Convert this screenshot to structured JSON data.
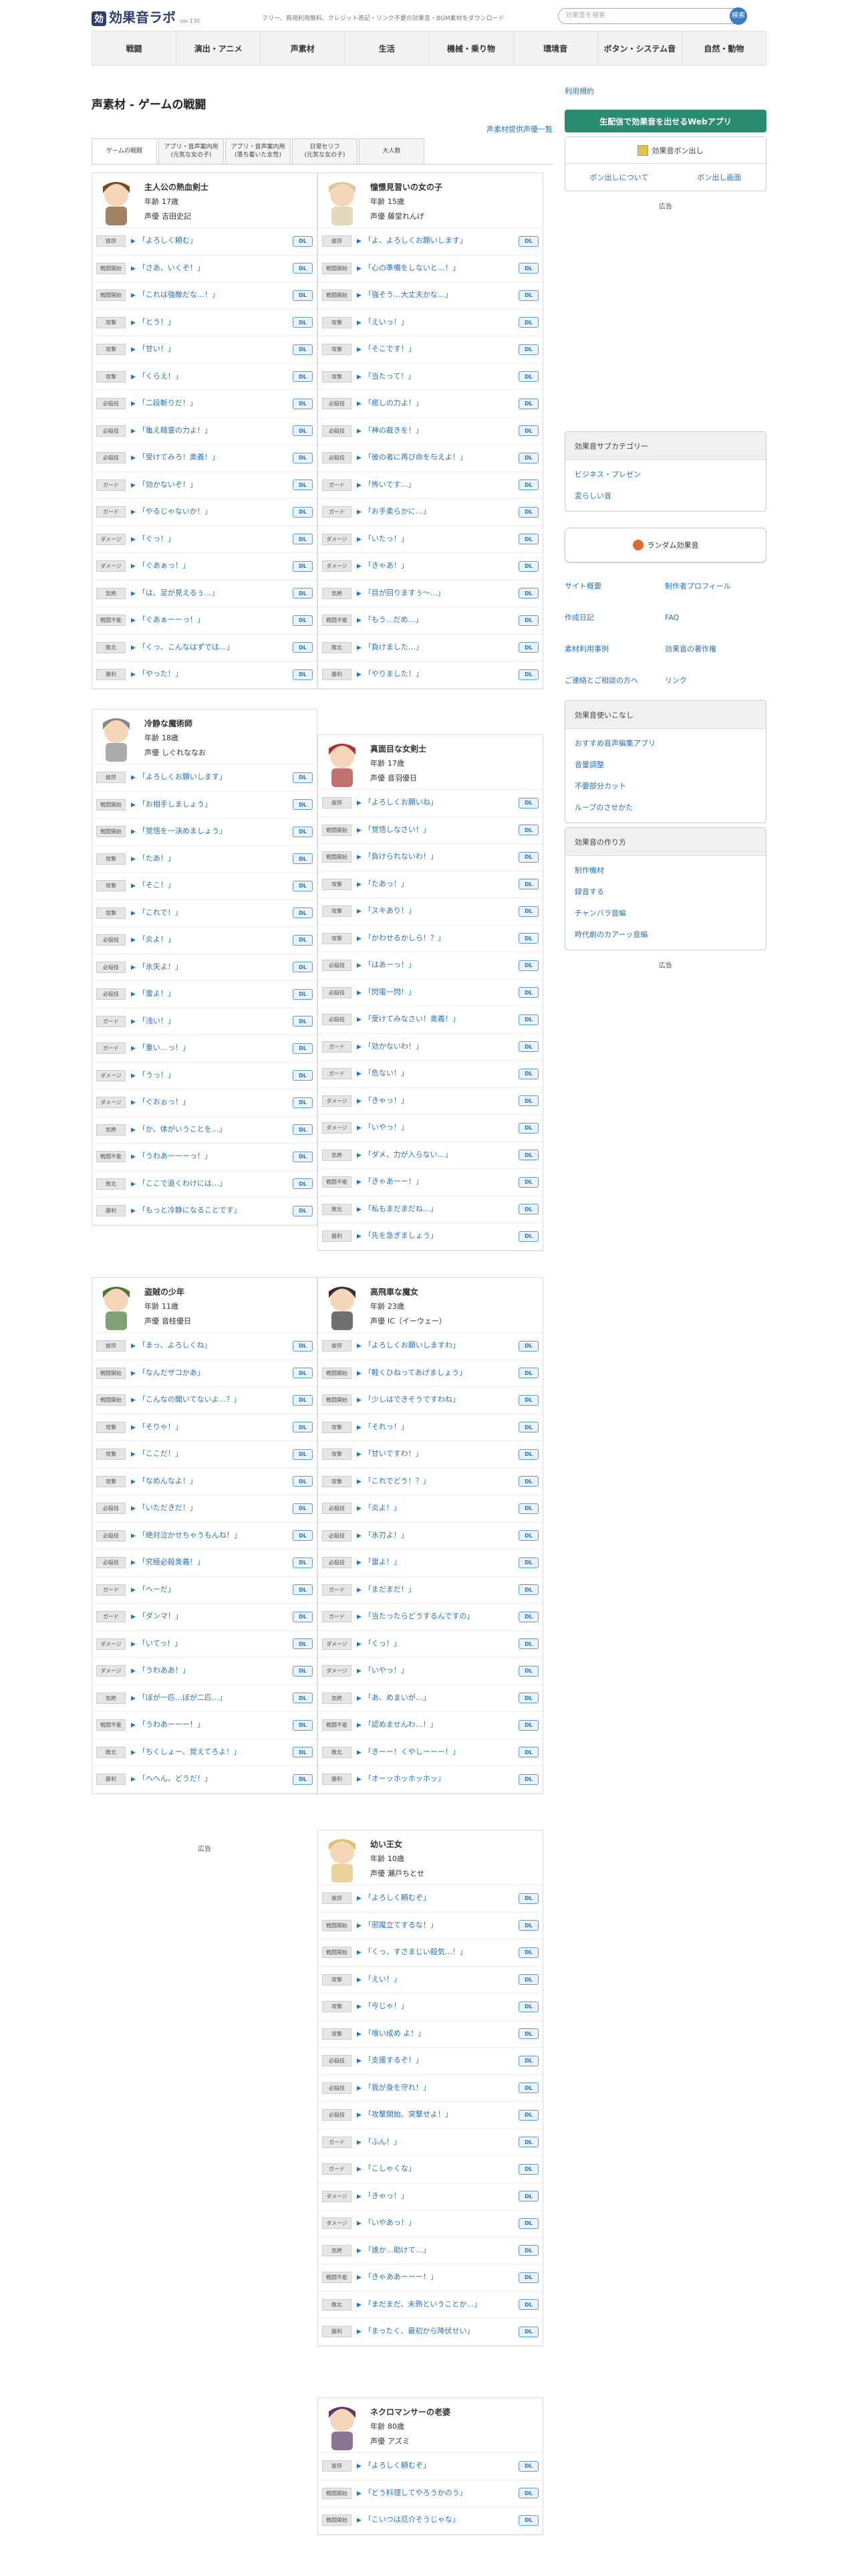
{
  "header": {
    "logo_mark": "効",
    "logo_text": "効果音ラボ",
    "version": "ver.130",
    "tagline": "フリー、商用利用無料、クレジット表記・リンク不要の効果音・BGM素材をダウンロード",
    "search_placeholder": "効果音を検索",
    "search_button": "検索"
  },
  "nav": [
    "戦闘",
    "演出・アニメ",
    "声素材",
    "生活",
    "機械・乗り物",
    "環境音",
    "ボタン・システム音",
    "自然・動物"
  ],
  "main": {
    "title": "声素材 - ゲームの戦闘",
    "provider_link": "声素材提供声優一覧",
    "tabs": [
      "ゲームの戦闘",
      "アプリ・音声案内用\n(元気な女の子)",
      "アプリ・音声案内用\n(落ち着いた女性)",
      "日常セリフ\n(元気な女の子)",
      "大人数"
    ]
  },
  "labels": {
    "age": "年齢",
    "voice": "声優",
    "play": "▶",
    "dl": "DL",
    "ad": "広告"
  },
  "characters": [
    {
      "name": "主人公の熱血剣士",
      "age": "17歳",
      "voice": "吉田史記",
      "lines": [
        [
          "挨拶",
          "「よろしく頼む」"
        ],
        [
          "戦闘開始",
          "「さあ、いくぞ！」"
        ],
        [
          "戦闘開始",
          "「これは強敵だな…！」"
        ],
        [
          "攻撃",
          "「とう！」"
        ],
        [
          "攻撃",
          "「甘い！」"
        ],
        [
          "攻撃",
          "「くらえ！」"
        ],
        [
          "必殺技",
          "「二段斬りだ！」"
        ],
        [
          "必殺技",
          "「亀え精霊の力よ！」"
        ],
        [
          "必殺技",
          "「受けてみろ！奥義！」"
        ],
        [
          "ガード",
          "「効かないぞ！」"
        ],
        [
          "ガード",
          "「やるじゃないか！」"
        ],
        [
          "ダメージ",
          "「ぐっ！」"
        ],
        [
          "ダメージ",
          "「ぐあぁっ！」"
        ],
        [
          "気絶",
          "「は、足が見えるぅ…」"
        ],
        [
          "戦闘不能",
          "「ぐあぁーーっ！」"
        ],
        [
          "敗北",
          "「くっ、こんなはずでは…」"
        ],
        [
          "勝利",
          "「やった！」"
        ]
      ]
    },
    {
      "name": "憧憬見習いの女の子",
      "age": "15歳",
      "voice": "藤堂れんげ",
      "lines": [
        [
          "挨拶",
          "「よ、よろしくお願いします」"
        ],
        [
          "戦闘開始",
          "「心の準備をしないと…！」"
        ],
        [
          "戦闘開始",
          "「強そう…大丈夫かな…」"
        ],
        [
          "攻撃",
          "「えいっ！」"
        ],
        [
          "攻撃",
          "「そこです！」"
        ],
        [
          "攻撃",
          "「当たって！」"
        ],
        [
          "必殺技",
          "「癒しの力よ！」"
        ],
        [
          "必殺技",
          "「神の裁きを！」"
        ],
        [
          "必殺技",
          "「彼の者に再び命を与えよ！」"
        ],
        [
          "ガード",
          "「怖いです…」"
        ],
        [
          "ガード",
          "「お手柔らかに…」"
        ],
        [
          "ダメージ",
          "「いたっ！」"
        ],
        [
          "ダメージ",
          "「きゃあ！」"
        ],
        [
          "気絶",
          "「目が回りますぅ〜…」"
        ],
        [
          "戦闘不能",
          "「もう…だめ…」"
        ],
        [
          "敗北",
          "「負けました…」"
        ],
        [
          "勝利",
          "「やりました！」"
        ]
      ]
    },
    {
      "name": "冷静な魔術師",
      "age": "18歳",
      "voice": "しぐれななお",
      "lines": [
        [
          "挨拶",
          "「よろしくお願いします」"
        ],
        [
          "戦闘開始",
          "「お相手しましょう」"
        ],
        [
          "戦闘開始",
          "「覚悟を一決めましょう」"
        ],
        [
          "攻撃",
          "「たあ！」"
        ],
        [
          "攻撃",
          "「そこ！」"
        ],
        [
          "攻撃",
          "「これで！」"
        ],
        [
          "必殺技",
          "「炎よ！」"
        ],
        [
          "必殺技",
          "「氷矢よ！」"
        ],
        [
          "必殺技",
          "「雷よ！」"
        ],
        [
          "ガード",
          "「浅い！」"
        ],
        [
          "ガード",
          "「重い…っ！」"
        ],
        [
          "ダメージ",
          "「うっ！」"
        ],
        [
          "ダメージ",
          "「ぐおぉっ！」"
        ],
        [
          "気絶",
          "「か、体がいうことを…」"
        ],
        [
          "戦闘不能",
          "「うわあーーーっ！」"
        ],
        [
          "敗北",
          "「ここで退くわけには…」"
        ],
        [
          "勝利",
          "「もっと冷静になることです」"
        ]
      ]
    },
    {
      "name": "真面目な女剣士",
      "age": "17歳",
      "voice": "音羽優日",
      "lines": [
        [
          "挨拶",
          "「よろしくお願いね」"
        ],
        [
          "戦闘開始",
          "「覚悟しなさい！」"
        ],
        [
          "戦闘開始",
          "「負けられないわ！」"
        ],
        [
          "攻撃",
          "「たあっ！」"
        ],
        [
          "攻撃",
          "「スキあり！」"
        ],
        [
          "攻撃",
          "「かわせるかしら！？」"
        ],
        [
          "必殺技",
          "「はあーっ！」"
        ],
        [
          "必殺技",
          "「閃電一閃！」"
        ],
        [
          "必殺技",
          "「受けてみなさい！奥義！」"
        ],
        [
          "ガード",
          "「効かないわ！」"
        ],
        [
          "ガード",
          "「危ない！」"
        ],
        [
          "ダメージ",
          "「きゃっ！」"
        ],
        [
          "ダメージ",
          "「いやっ！」"
        ],
        [
          "気絶",
          "「ダメ、力が入らない…」"
        ],
        [
          "戦闘不能",
          "「きゃあーー！」"
        ],
        [
          "敗北",
          "「私もまだまだね…」"
        ],
        [
          "勝利",
          "「先を急ぎましょう」"
        ]
      ]
    },
    {
      "name": "盗賊の少年",
      "age": "11歳",
      "voice": "音桂優日",
      "lines": [
        [
          "挨拶",
          "「まっ、よろしくね」"
        ],
        [
          "戦闘開始",
          "「なんだザコかあ」"
        ],
        [
          "戦闘開始",
          "「こんなの聞いてないよ…？」"
        ],
        [
          "攻撃",
          "「そりゃ！」"
        ],
        [
          "攻撃",
          "「ここだ！」"
        ],
        [
          "攻撃",
          "「なめんなよ！」"
        ],
        [
          "必殺技",
          "「いただきだ！」"
        ],
        [
          "必殺技",
          "「絶対泣かせちゃうもんね！」"
        ],
        [
          "必殺技",
          "「究極必殺奥義！」"
        ],
        [
          "ガード",
          "「へーだ」"
        ],
        [
          "ガード",
          "「ダンマ！」"
        ],
        [
          "ダメージ",
          "「いてっ！」"
        ],
        [
          "ダメージ",
          "「うわああ！」"
        ],
        [
          "気絶",
          "「ぼが一匹…ぼが二匹…」"
        ],
        [
          "戦闘不能",
          "「うわあーーー！」"
        ],
        [
          "敗北",
          "「ちくしょー、覚えてろよ！」"
        ],
        [
          "勝利",
          "「へへん、どうだ！」"
        ]
      ]
    },
    {
      "name": "高飛車な魔女",
      "age": "23歳",
      "voice": "IC（イーウェー）",
      "lines": [
        [
          "挨拶",
          "「よろしくお願いしますわ」"
        ],
        [
          "戦闘開始",
          "「軽くひねってあげましょう」"
        ],
        [
          "戦闘開始",
          "「少しはできそうですわね」"
        ],
        [
          "攻撃",
          "「それっ！」"
        ],
        [
          "攻撃",
          "「甘いですわ！」"
        ],
        [
          "攻撃",
          "「これでどう！？」"
        ],
        [
          "必殺技",
          "「炎よ！」"
        ],
        [
          "必殺技",
          "「氷刃よ！」"
        ],
        [
          "必殺技",
          "「雷よ！」"
        ],
        [
          "ガード",
          "「まだまだ！」"
        ],
        [
          "ガード",
          "「当たったらどうするんですの」"
        ],
        [
          "ダメージ",
          "「くっ！」"
        ],
        [
          "ダメージ",
          "「いやっ！」"
        ],
        [
          "気絶",
          "「あ、めまいが…」"
        ],
        [
          "戦闘不能",
          "「認めませんわ…！」"
        ],
        [
          "敗北",
          "「きーー！くやしーーー！」"
        ],
        [
          "勝利",
          "「オーッホッホッホッ」"
        ]
      ]
    },
    {
      "name": "幼い王女",
      "age": "10歳",
      "voice": "瀬戸ちとせ",
      "lines": [
        [
          "挨拶",
          "「よろしく頼むぞ」"
        ],
        [
          "戦闘開始",
          "「邪魔立てするな！」"
        ],
        [
          "戦闘開始",
          "「くっ、すさまじい殺気…！」"
        ],
        [
          "攻撃",
          "「えい！」"
        ],
        [
          "攻撃",
          "「今じゃ！」"
        ],
        [
          "攻撃",
          "「喰い成め よ！」"
        ],
        [
          "必殺技",
          "「支援するぞ！」"
        ],
        [
          "必殺技",
          "「我が身を守れ！」"
        ],
        [
          "必殺技",
          "「攻撃開始、突撃せよ！」"
        ],
        [
          "ガード",
          "「ふん！」"
        ],
        [
          "ガード",
          "「こしゃくな」"
        ],
        [
          "ダメージ",
          "「きゃっ！」"
        ],
        [
          "ダメージ",
          "「いやあっ！」"
        ],
        [
          "気絶",
          "「誰か…助けて…」"
        ],
        [
          "戦闘不能",
          "「きゃああーーー！」"
        ],
        [
          "敗北",
          "「まだまだ、未熟ということか…」"
        ],
        [
          "勝利",
          "「まったく、最初から降伏せい」"
        ]
      ]
    },
    {
      "name": "ネクロマンサーの老婆",
      "age": "80歳",
      "voice": "アズミ",
      "lines": [
        [
          "挨拶",
          "「よろしく頼むぞ」"
        ],
        [
          "戦闘開始",
          "「どう料理してやろうかのう」"
        ],
        [
          "戦闘開始",
          "「こいつは厄介そうじゃな」"
        ]
      ]
    }
  ],
  "sidebar": {
    "top_link": "利用規約",
    "app_button": "生配信で効果音を出せるWebアプリ",
    "pon_title": "効果音ボン出し",
    "pon_about": "ボン出しについて",
    "pon_screen": "ボン出し画面",
    "subcat_title": "効果音サブカテゴリー",
    "subcat_items": [
      "ビジネス・プレゼン",
      "変らしい音"
    ],
    "random_button": "ランダム効果音",
    "links": [
      "サイト概要",
      "制作者プロフィール",
      "作成日記",
      "FAQ",
      "素材利用事例",
      "効果音の著作権",
      "ご連絡とご相談の方へ",
      "リンク"
    ],
    "usage_title": "効果音使いこなし",
    "usage_items": [
      "おすすめ音声編集アプリ",
      "音量調整",
      "不要部分カット",
      "ループのさせかた"
    ],
    "make_title": "効果音の作り方",
    "make_items": [
      "制作機材",
      "録音する",
      "チャンバラ音編",
      "時代劇のカアーッ音編"
    ]
  },
  "colors": {
    "link": "#2b73b8",
    "accent_green": "#2a8c6e",
    "navy": "#2c3e6b"
  }
}
